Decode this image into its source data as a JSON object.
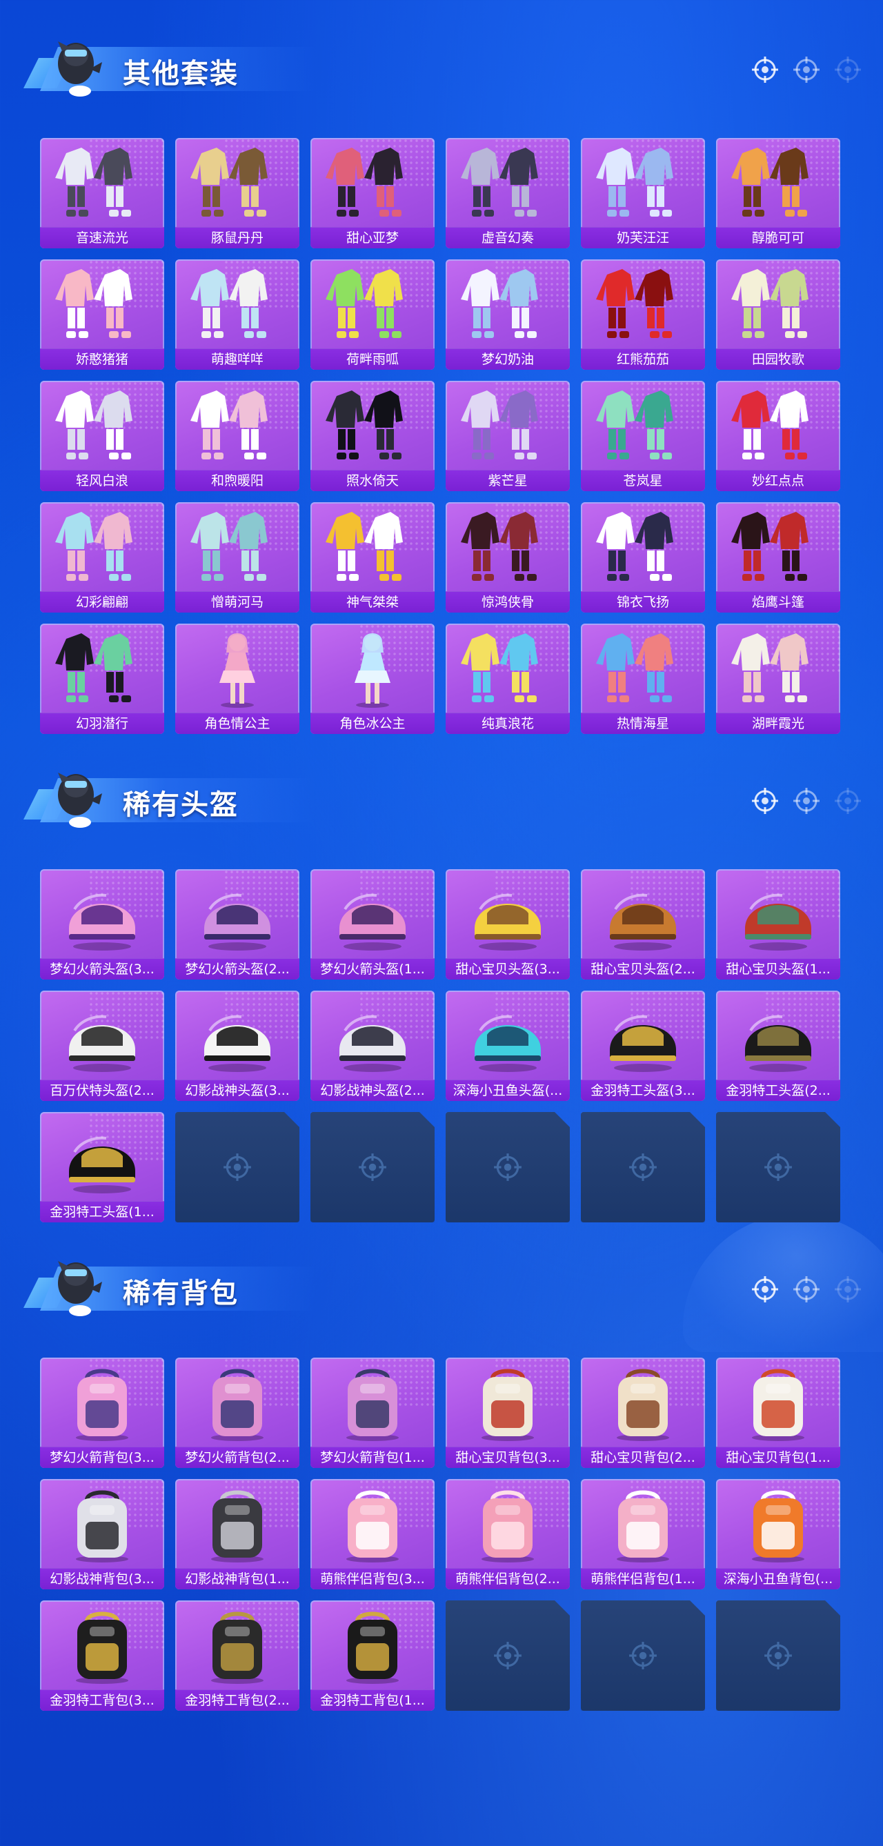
{
  "colors": {
    "background": "#0a4ad6",
    "card_purple": "#a852e6",
    "label_purple": "#7a21d4",
    "empty_slot": "#1e3c73",
    "title_text": "#ffffff"
  },
  "sections": [
    {
      "title": "其他套装",
      "items": [
        {
          "label": "音速流光",
          "icon": "outfit-icon",
          "palette": [
            "#e8eaf5",
            "#4a4a5a"
          ]
        },
        {
          "label": "豚鼠丹丹",
          "icon": "outfit-icon",
          "palette": [
            "#e8cf8e",
            "#7a5a36"
          ]
        },
        {
          "label": "甜心亚梦",
          "icon": "outfit-icon",
          "palette": [
            "#e0607a",
            "#2a2230"
          ]
        },
        {
          "label": "虚音幻奏",
          "icon": "outfit-icon",
          "palette": [
            "#b8b6d8",
            "#3a3852"
          ]
        },
        {
          "label": "奶芙汪汪",
          "icon": "outfit-icon",
          "palette": [
            "#dfe8ff",
            "#9bb8f0"
          ]
        },
        {
          "label": "醇脆可可",
          "icon": "outfit-icon",
          "palette": [
            "#f0a24a",
            "#6a3a1a"
          ]
        },
        {
          "label": "娇憨猪猪",
          "icon": "outfit-icon",
          "palette": [
            "#f8b8c6",
            "#ffffff"
          ]
        },
        {
          "label": "萌趣咩咩",
          "icon": "outfit-icon",
          "palette": [
            "#bfe4f4",
            "#f2f2f2"
          ]
        },
        {
          "label": "荷畔雨呱",
          "icon": "outfit-icon",
          "palette": [
            "#8ee060",
            "#f0e04a"
          ]
        },
        {
          "label": "梦幻奶油",
          "icon": "outfit-icon",
          "palette": [
            "#f4f4ff",
            "#9ec8f0"
          ]
        },
        {
          "label": "红熊茄茄",
          "icon": "outfit-icon",
          "palette": [
            "#e02a2a",
            "#8a1010"
          ]
        },
        {
          "label": "田园牧歌",
          "icon": "outfit-icon",
          "palette": [
            "#f4f0d8",
            "#c8d890"
          ]
        },
        {
          "label": "轻风白浪",
          "icon": "outfit-icon",
          "palette": [
            "#ffffff",
            "#dcdcee"
          ]
        },
        {
          "label": "和煦暖阳",
          "icon": "outfit-icon",
          "palette": [
            "#ffffff",
            "#f0c0d8"
          ]
        },
        {
          "label": "照水倚天",
          "icon": "outfit-icon",
          "palette": [
            "#2a2a36",
            "#111118"
          ]
        },
        {
          "label": "紫芒星",
          "icon": "outfit-icon",
          "palette": [
            "#e0d8f4",
            "#8a6ac8"
          ]
        },
        {
          "label": "苍岚星",
          "icon": "outfit-icon",
          "palette": [
            "#8ee0c0",
            "#3aa890"
          ]
        },
        {
          "label": "妙红点点",
          "icon": "outfit-icon",
          "palette": [
            "#e02a3a",
            "#ffffff"
          ]
        },
        {
          "label": "幻彩翩翩",
          "icon": "outfit-icon",
          "palette": [
            "#a8e0f0",
            "#f0b8d0"
          ]
        },
        {
          "label": "憎萌河马",
          "icon": "outfit-icon",
          "palette": [
            "#bce4e8",
            "#8ac8d0"
          ]
        },
        {
          "label": "神气桀桀",
          "icon": "outfit-icon",
          "palette": [
            "#f4c030",
            "#ffffff"
          ]
        },
        {
          "label": "惊鸿侠骨",
          "icon": "outfit-icon",
          "palette": [
            "#3a1a22",
            "#8a2a34"
          ]
        },
        {
          "label": "锦衣飞扬",
          "icon": "outfit-icon",
          "palette": [
            "#ffffff",
            "#2a2a4a"
          ]
        },
        {
          "label": "焰鹰斗篷",
          "icon": "outfit-icon",
          "palette": [
            "#2a1418",
            "#c02a2a"
          ]
        },
        {
          "label": "幻羽潜行",
          "icon": "outfit-icon",
          "palette": [
            "#1a1a22",
            "#6ad0a0"
          ]
        },
        {
          "label": "角色情公主",
          "icon": "figure-icon",
          "palette": [
            "#f4a8c8",
            "#ffd0e0"
          ]
        },
        {
          "label": "角色冰公主",
          "icon": "figure-icon",
          "palette": [
            "#bfe8ff",
            "#e8f6ff"
          ]
        },
        {
          "label": "纯真浪花",
          "icon": "outfit-icon",
          "palette": [
            "#f4e060",
            "#60c8f0"
          ]
        },
        {
          "label": "热情海星",
          "icon": "outfit-icon",
          "palette": [
            "#60b0f0",
            "#f08080"
          ]
        },
        {
          "label": "湖畔霞光",
          "icon": "outfit-icon",
          "palette": [
            "#f4f0e8",
            "#f0c8c8"
          ]
        }
      ]
    },
    {
      "title": "稀有头盔",
      "items": [
        {
          "label": "梦幻火箭头盔(3...",
          "icon": "helmet-icon",
          "palette": [
            "#f0a0d8",
            "#5a2a8a"
          ]
        },
        {
          "label": "梦幻火箭头盔(2...",
          "icon": "helmet-icon",
          "palette": [
            "#d090e0",
            "#3a2a6a"
          ]
        },
        {
          "label": "梦幻火箭头盔(1...",
          "icon": "helmet-icon",
          "palette": [
            "#e890d0",
            "#4a2a6a"
          ]
        },
        {
          "label": "甜心宝贝头盔(3...",
          "icon": "helmet-icon",
          "palette": [
            "#f4d040",
            "#8a5a2a"
          ]
        },
        {
          "label": "甜心宝贝头盔(2...",
          "icon": "helmet-icon",
          "palette": [
            "#c87a30",
            "#6a3a1a"
          ]
        },
        {
          "label": "甜心宝贝头盔(1...",
          "icon": "helmet-icon",
          "palette": [
            "#c03a2a",
            "#4a8a6a"
          ]
        },
        {
          "label": "百万伏特头盔(2...",
          "icon": "helmet-icon",
          "palette": [
            "#f0f0f0",
            "#2a2a2a"
          ]
        },
        {
          "label": "幻影战神头盔(3...",
          "icon": "helmet-icon",
          "palette": [
            "#f4f4f4",
            "#1a1a1a"
          ]
        },
        {
          "label": "幻影战神头盔(2...",
          "icon": "helmet-icon",
          "palette": [
            "#e8e8f0",
            "#2a2a3a"
          ]
        },
        {
          "label": "深海小丑鱼头盔(...",
          "icon": "helmet-icon",
          "palette": [
            "#40d0e0",
            "#1a4a6a"
          ]
        },
        {
          "label": "金羽特工头盔(3...",
          "icon": "helmet-icon",
          "palette": [
            "#1a1a1a",
            "#d8b040"
          ]
        },
        {
          "label": "金羽特工头盔(2...",
          "icon": "helmet-icon",
          "palette": [
            "#1a1a1a",
            "#8a7a40"
          ]
        },
        {
          "label": "金羽特工头盔(1...",
          "icon": "helmet-icon",
          "palette": [
            "#121212",
            "#d8b040"
          ]
        }
      ],
      "empty_slots": 5
    },
    {
      "title": "稀有背包",
      "items": [
        {
          "label": "梦幻火箭背包(3...",
          "icon": "backpack-icon",
          "palette": [
            "#f0a0d8",
            "#4a3a8a"
          ]
        },
        {
          "label": "梦幻火箭背包(2...",
          "icon": "backpack-icon",
          "palette": [
            "#e090d0",
            "#3a3a7a"
          ]
        },
        {
          "label": "梦幻火箭背包(1...",
          "icon": "backpack-icon",
          "palette": [
            "#d890d8",
            "#3a3a6a"
          ]
        },
        {
          "label": "甜心宝贝背包(3...",
          "icon": "backpack-icon",
          "palette": [
            "#f0e8d8",
            "#c03a2a"
          ]
        },
        {
          "label": "甜心宝贝背包(2...",
          "icon": "backpack-icon",
          "palette": [
            "#f0e0c8",
            "#8a4a2a"
          ]
        },
        {
          "label": "甜心宝贝背包(1...",
          "icon": "backpack-icon",
          "palette": [
            "#f4f0e8",
            "#d04a2a"
          ]
        },
        {
          "label": "幻影战神背包(3...",
          "icon": "backpack-icon",
          "palette": [
            "#e0e0e8",
            "#2a2a30"
          ]
        },
        {
          "label": "幻影战神背包(1...",
          "icon": "backpack-icon",
          "palette": [
            "#3a3a40",
            "#c8c8d0"
          ]
        },
        {
          "label": "萌熊伴侣背包(3...",
          "icon": "backpack-icon",
          "palette": [
            "#f8b0c8",
            "#ffffff"
          ]
        },
        {
          "label": "萌熊伴侣背包(2...",
          "icon": "backpack-icon",
          "palette": [
            "#f4a0b8",
            "#ffe0e8"
          ]
        },
        {
          "label": "萌熊伴侣背包(1...",
          "icon": "backpack-icon",
          "palette": [
            "#f4b0c8",
            "#ffffff"
          ]
        },
        {
          "label": "深海小丑鱼背包(...",
          "icon": "backpack-icon",
          "palette": [
            "#f07a2a",
            "#ffffff"
          ]
        },
        {
          "label": "金羽特工背包(3...",
          "icon": "backpack-icon",
          "palette": [
            "#1e1e1e",
            "#d8b040"
          ]
        },
        {
          "label": "金羽特工背包(2...",
          "icon": "backpack-icon",
          "palette": [
            "#2a2a2a",
            "#b89840"
          ]
        },
        {
          "label": "金羽特工背包(1...",
          "icon": "backpack-icon",
          "palette": [
            "#1a1a1a",
            "#d0a840"
          ]
        }
      ],
      "empty_slots": 3
    }
  ]
}
